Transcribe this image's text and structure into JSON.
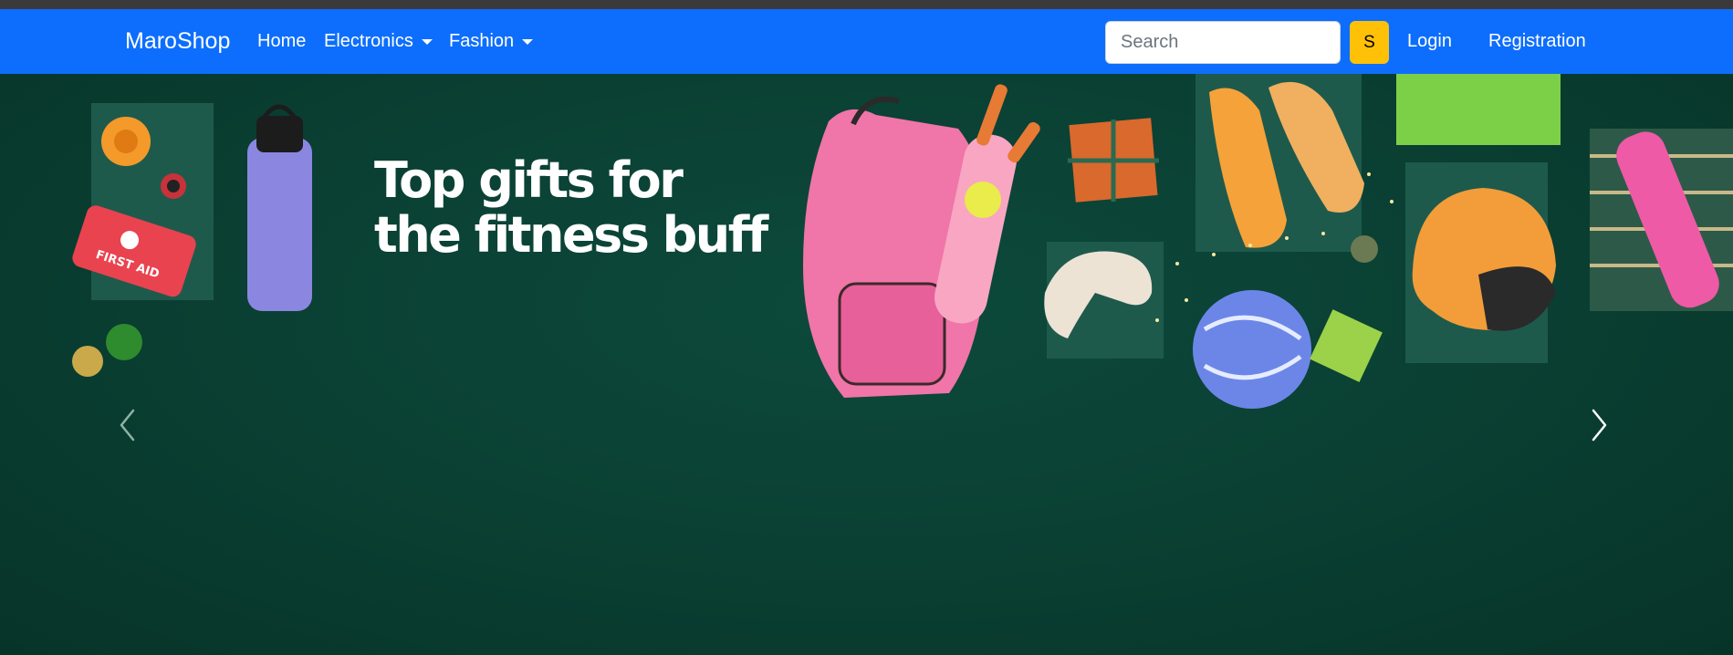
{
  "brand": "MaroShop",
  "nav": {
    "home": "Home",
    "electronics": "Electronics",
    "fashion": "Fashion"
  },
  "search": {
    "placeholder": "Search",
    "button_label": "S"
  },
  "auth": {
    "login": "Login",
    "registration": "Registration"
  },
  "hero": {
    "line1": "Top gifts for",
    "line2": "the fitness buff",
    "prev_icon": "chevron-left-icon",
    "next_icon": "chevron-right-icon"
  },
  "colors": {
    "navbar": "#0d6efd",
    "search_button": "#ffc107",
    "hero_background": "#0a4033"
  }
}
